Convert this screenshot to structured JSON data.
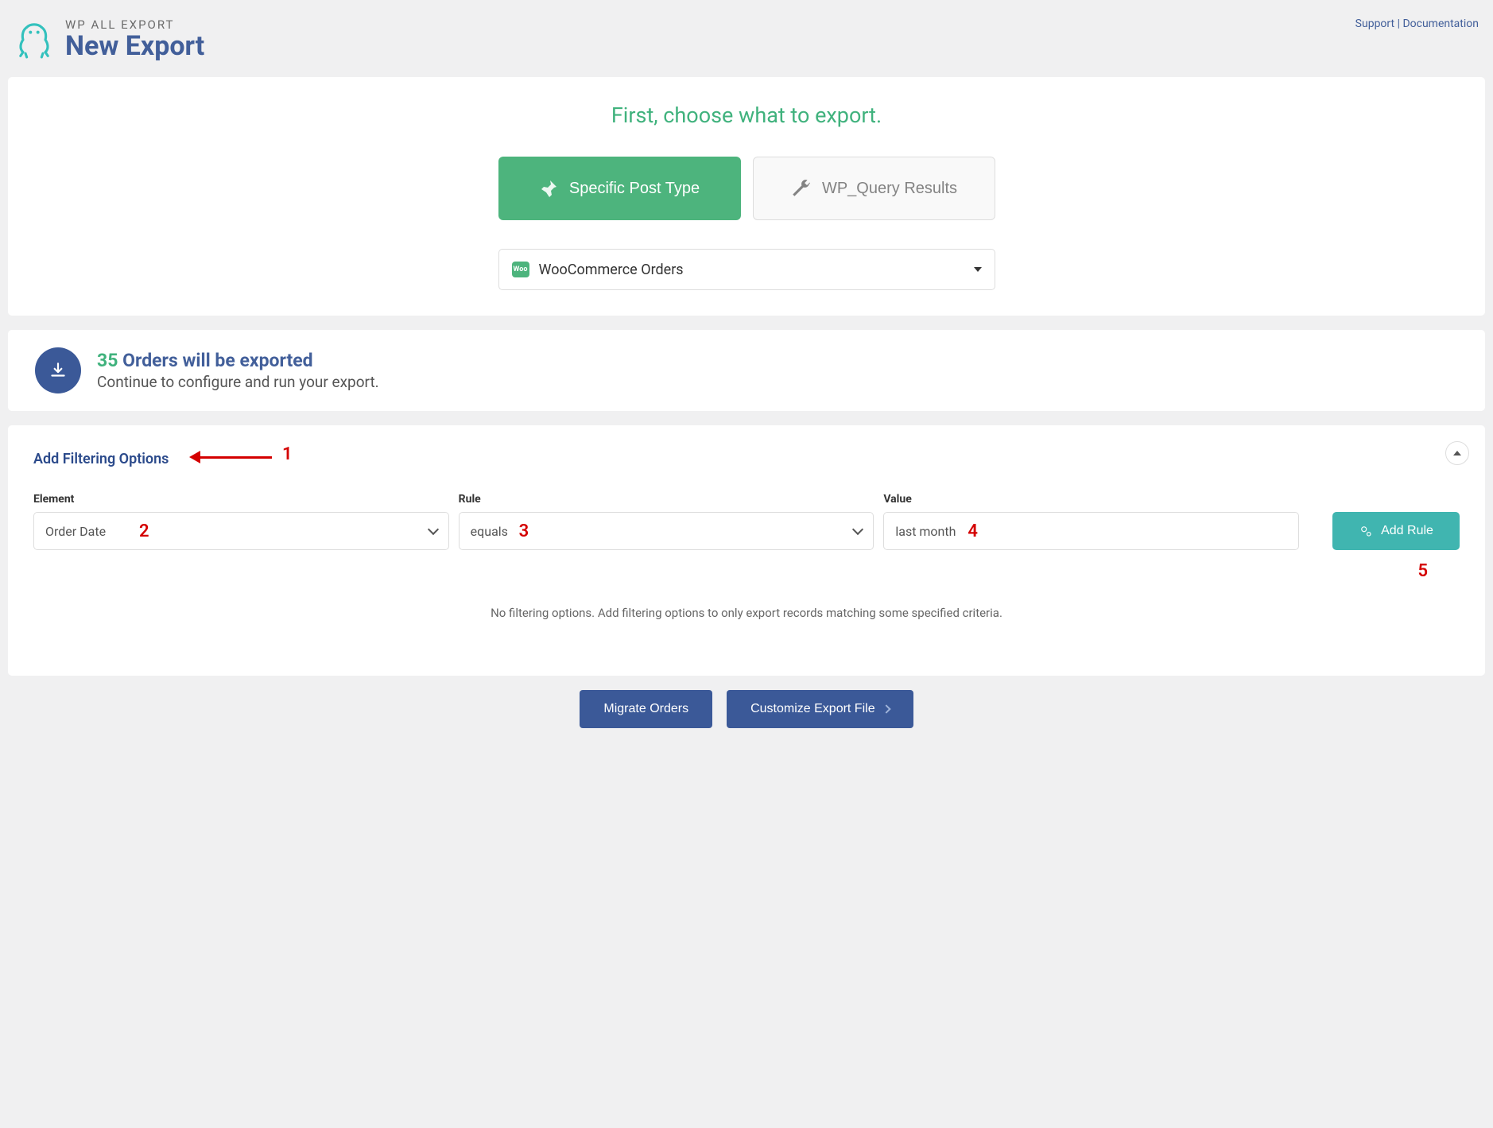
{
  "header": {
    "brand": "WP ALL EXPORT",
    "title": "New Export",
    "links": {
      "support": "Support",
      "documentation": "Documentation"
    }
  },
  "choose": {
    "heading": "First, choose what to export.",
    "btn_specific": "Specific Post Type",
    "btn_query": "WP_Query Results",
    "select_label": "WooCommerce Orders",
    "woo_badge": "Woo"
  },
  "summary": {
    "count": "35",
    "title_rest": " Orders will be exported",
    "subtitle": "Continue to configure and run your export."
  },
  "filter": {
    "heading": "Add Filtering Options",
    "labels": {
      "element": "Element",
      "rule": "Rule",
      "value": "Value"
    },
    "values": {
      "element": "Order Date",
      "rule": "equals",
      "value": "last month"
    },
    "add_rule": "Add Rule",
    "empty": "No filtering options. Add filtering options to only export records matching some specified criteria."
  },
  "footer": {
    "migrate": "Migrate Orders",
    "customize": "Customize Export File"
  },
  "annotations": {
    "a1": "1",
    "a2": "2",
    "a3": "3",
    "a4": "4",
    "a5": "5"
  }
}
